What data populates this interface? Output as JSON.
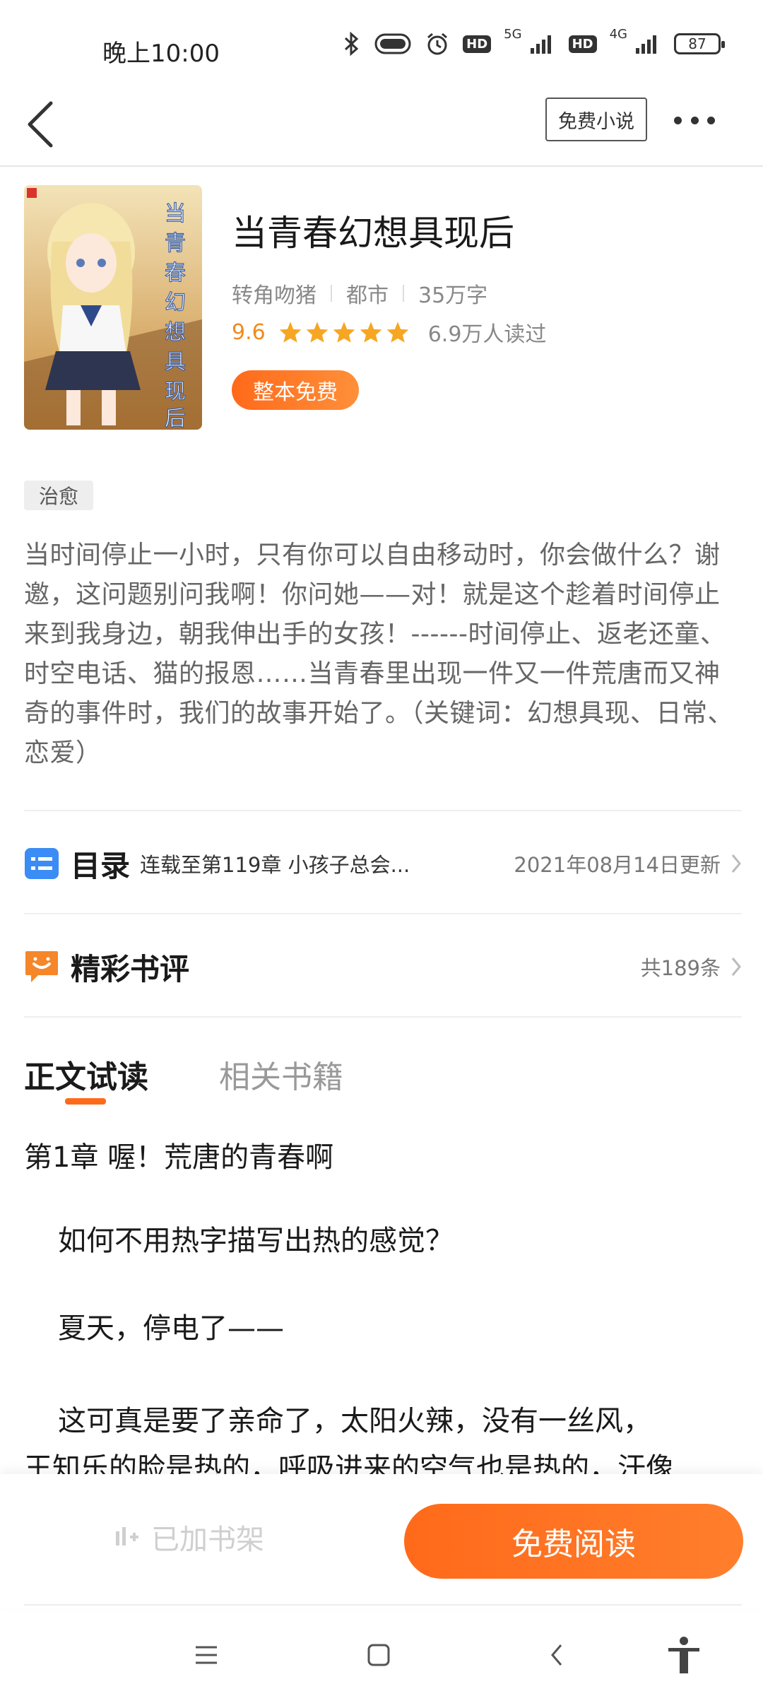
{
  "status_bar": {
    "time": "晚上10:00",
    "network_1": "5G",
    "network_2": "4G",
    "hd_label": "HD",
    "battery": "87"
  },
  "nav": {
    "free_novel_label": "免费小说"
  },
  "book": {
    "title": "当青春幻想具现后",
    "author": "转角吻猪",
    "category": "都市",
    "word_count": "35万字",
    "rating": "9.6",
    "stars": 5,
    "readers": "6.9万人读过",
    "free_label": "整本免费",
    "tag": "治愈",
    "synopsis": "当时间停止一小时，只有你可以自由移动时，你会做什么？谢邀，这问题别问我啊！你问她——对！就是这个趁着时间停止来到我身边，朝我伸出手的女孩！------时间停止、返老还童、时空电话、猫的报恩……当青春里出现一件又一件荒唐而又神奇的事件时，我们的故事开始了。（关键词：幻想具现、日常、恋爱）"
  },
  "catalog": {
    "title": "目录",
    "latest": "连载至第119章 小孩子总会...",
    "updated": "2021年08月14日更新"
  },
  "reviews": {
    "title": "精彩书评",
    "count": "共189条"
  },
  "tabs": [
    {
      "label": "正文试读"
    },
    {
      "label": "相关书籍"
    }
  ],
  "preview": {
    "chapter_title": "第1章 喔！荒唐的青春啊",
    "paragraphs": [
      "如何不用热字描写出热的感觉？",
      "夏天，停电了——",
      "这可真是要了亲命了，太阳火辣，没有一丝风，",
      "王知乐的脸是热的，呼吸进来的空气也是热的，汗像"
    ]
  },
  "actions": {
    "shelf_label": "已加书架",
    "read_label": "免费阅读"
  },
  "colors": {
    "accent": "#ff6a1a",
    "star": "#f6a623",
    "catalog_icon": "#3b8cf5"
  }
}
